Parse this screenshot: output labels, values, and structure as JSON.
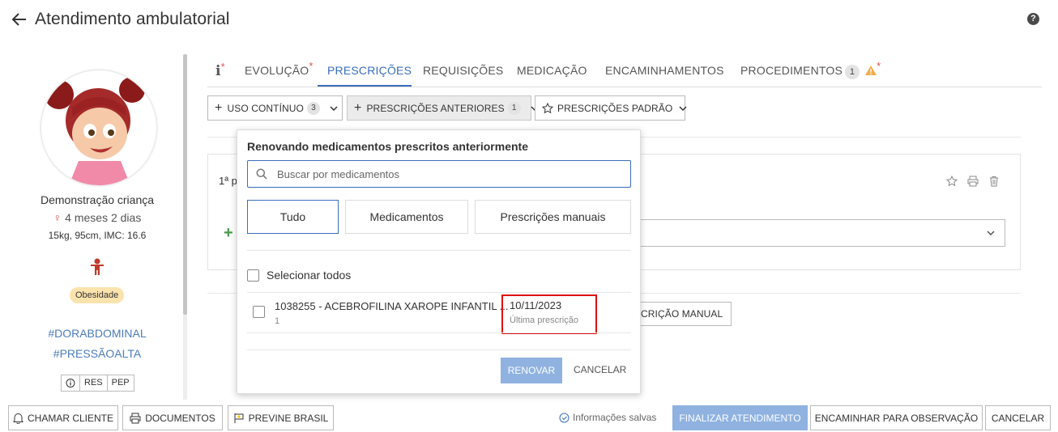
{
  "header": {
    "title": "Atendimento ambulatorial",
    "help": "?"
  },
  "patient": {
    "name": "Demonstração criança",
    "age": "4 meses 2 dias",
    "measurements": "15kg, 95cm, IMC: 16.6",
    "badge": "Obesidade",
    "tags": [
      "#DORABDOMINAL",
      "#PRESSÃOALTA"
    ],
    "mini_buttons": [
      "i",
      "RES",
      "PEP"
    ]
  },
  "tabs": [
    {
      "label": "i",
      "required": "*"
    },
    {
      "label": "EVOLUÇÃO",
      "required": "*"
    },
    {
      "label": "PRESCRIÇÕES"
    },
    {
      "label": "REQUISIÇÕES"
    },
    {
      "label": "MEDICAÇÃO"
    },
    {
      "label": "ENCAMINHAMENTOS"
    },
    {
      "label": "PROCEDIMENTOS",
      "count": "1",
      "required": "*"
    }
  ],
  "toolbar": {
    "continuous": {
      "label": "USO CONTÍNUO",
      "count": "3"
    },
    "previous": {
      "label": "PRESCRIÇÕES ANTERIORES",
      "count": "1"
    },
    "standard": {
      "label": "PRESCRIÇÕES PADRÃO"
    }
  },
  "card": {
    "label_prefix": "1ª p",
    "manual_button": "CRIÇÃO MANUAL"
  },
  "dropdown": {
    "title": "Renovando medicamentos prescritos anteriormente",
    "search_placeholder": "Buscar por medicamentos",
    "filters": [
      "Tudo",
      "Medicamentos",
      "Prescrições manuais"
    ],
    "select_all": "Selecionar todos",
    "item": {
      "name": "1038255 - ACEBROFILINA XAROPE INFANTIL ...",
      "qty": "1",
      "date": "10/11/2023",
      "date_label": "Última prescrição"
    },
    "renew": "RENOVAR",
    "cancel": "CANCELAR"
  },
  "footer": {
    "call_client": "CHAMAR CLIENTE",
    "documents": "DOCUMENTOS",
    "previne": "PREVINE BRASIL",
    "saved": "Informações salvas",
    "finalize": "FINALIZAR ATENDIMENTO",
    "forward": "ENCAMINHAR PARA OBSERVAÇÃO",
    "cancel": "CANCELAR"
  },
  "colors": {
    "accent": "#3a6dbc",
    "required": "#d9534f",
    "warning": "#f0ad4e",
    "highlight": "#e01010",
    "disabled_primary": "#8fb2e0"
  }
}
